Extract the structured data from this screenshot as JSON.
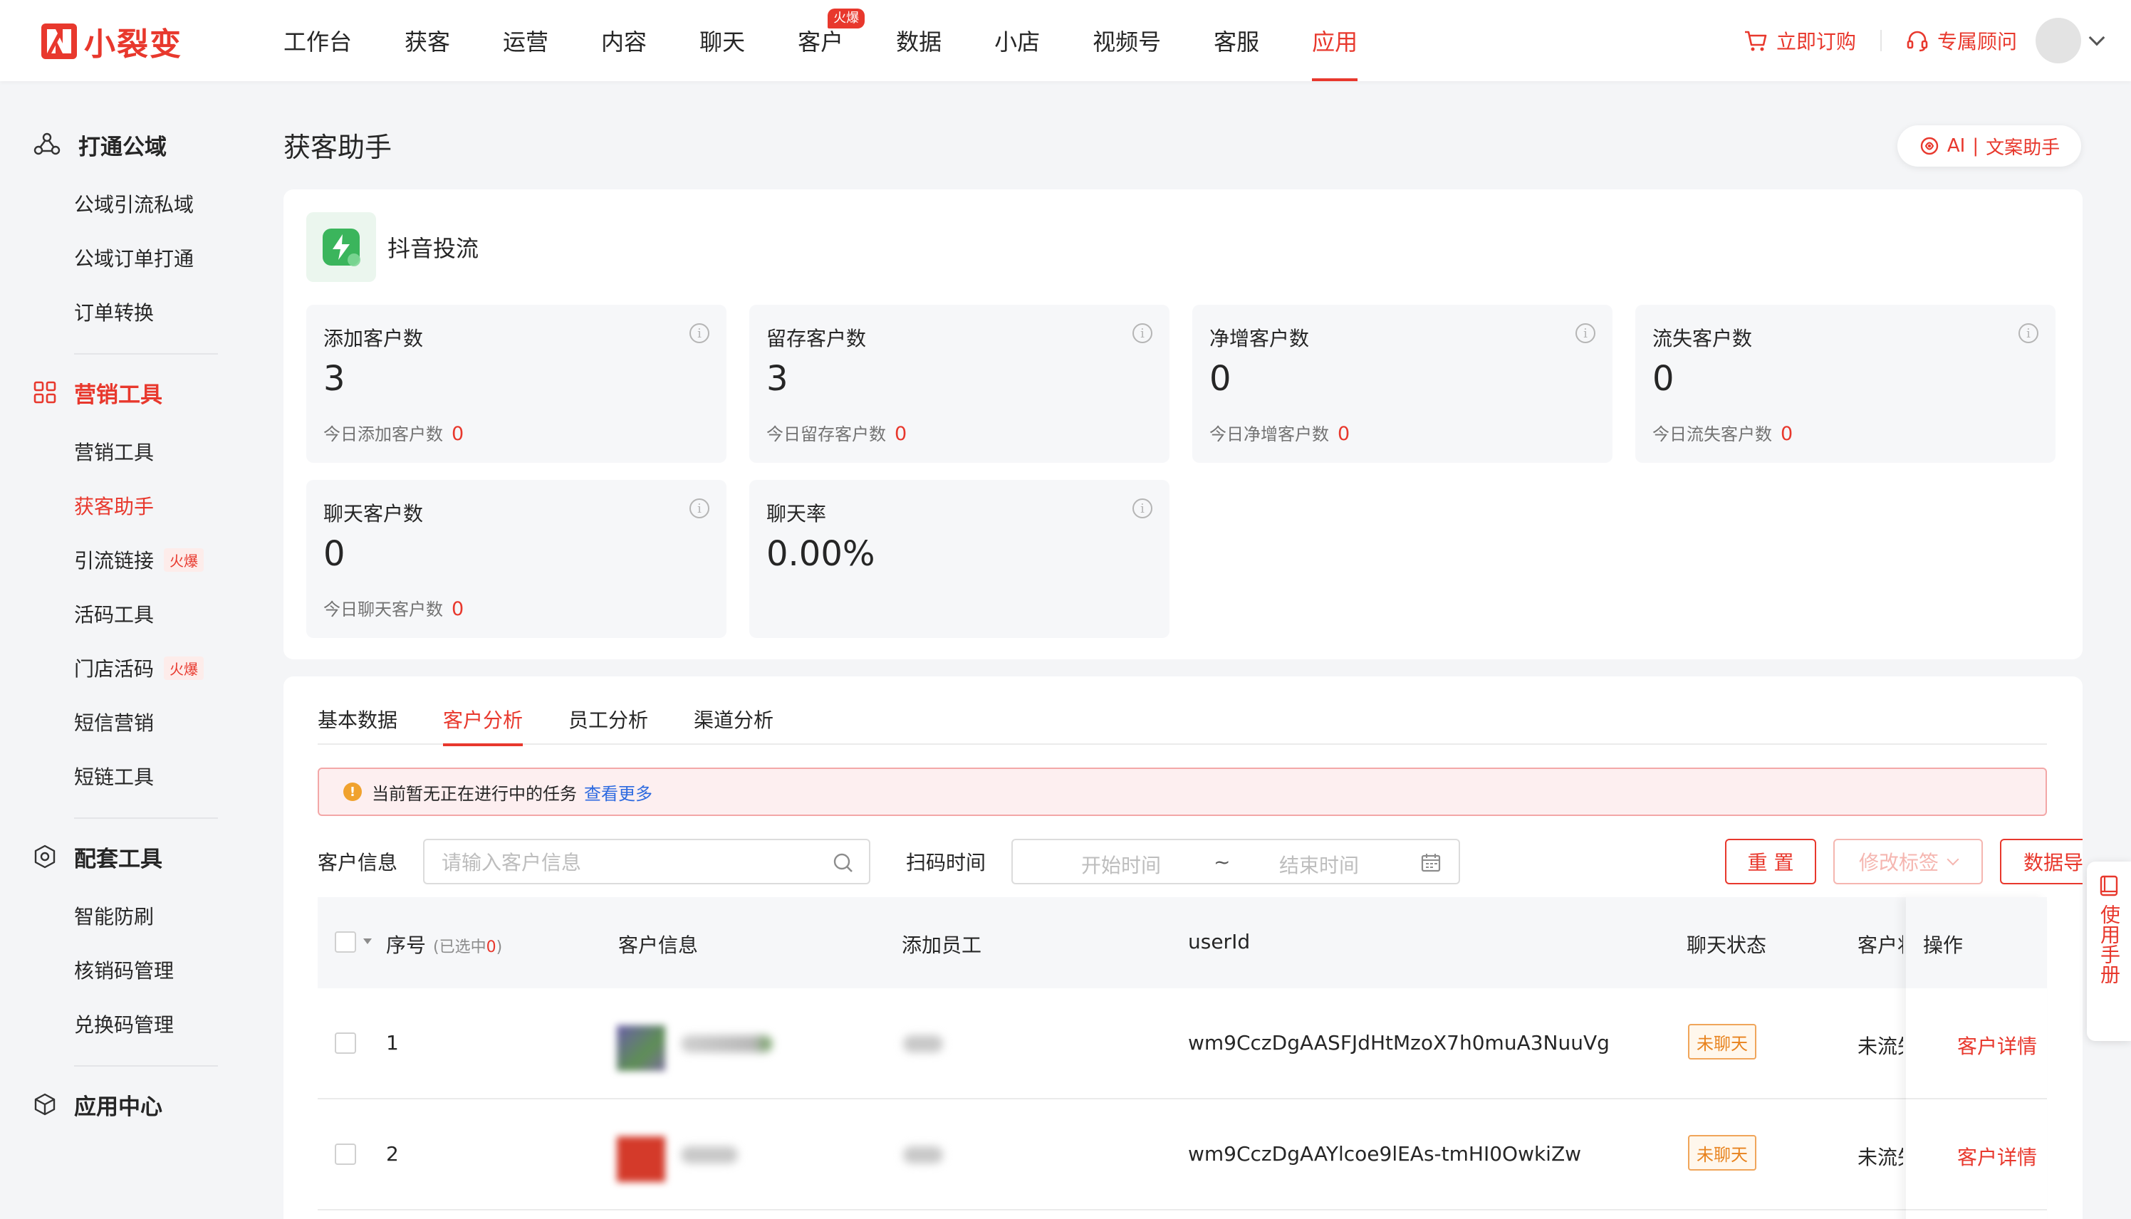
{
  "brand": {
    "name": "小裂变",
    "color": "#e8382d"
  },
  "nav": {
    "items": [
      {
        "label": "工作台"
      },
      {
        "label": "获客"
      },
      {
        "label": "运营"
      },
      {
        "label": "内容"
      },
      {
        "label": "聊天"
      },
      {
        "label": "客户",
        "badge": "火爆"
      },
      {
        "label": "数据"
      },
      {
        "label": "小店"
      },
      {
        "label": "视频号"
      },
      {
        "label": "客服"
      },
      {
        "label": "应用",
        "active": true
      }
    ],
    "buy_label": "立即订购",
    "advisor_label": "专属顾问"
  },
  "sidebar": {
    "groups": [
      {
        "title": "打通公域",
        "icon": "network-icon",
        "items": [
          {
            "label": "公域引流私域"
          },
          {
            "label": "公域订单打通"
          },
          {
            "label": "订单转换"
          }
        ]
      },
      {
        "title": "营销工具",
        "icon": "grid-icon",
        "active": true,
        "items": [
          {
            "label": "营销工具"
          },
          {
            "label": "获客助手",
            "active": true
          },
          {
            "label": "引流链接",
            "badge": "火爆"
          },
          {
            "label": "活码工具"
          },
          {
            "label": "门店活码",
            "badge": "火爆"
          },
          {
            "label": "短信营销"
          },
          {
            "label": "短链工具"
          }
        ]
      },
      {
        "title": "配套工具",
        "icon": "shield-icon",
        "items": [
          {
            "label": "智能防刷"
          },
          {
            "label": "核销码管理"
          },
          {
            "label": "兑换码管理"
          }
        ]
      },
      {
        "title": "应用中心",
        "icon": "cube-icon",
        "items": []
      }
    ]
  },
  "page": {
    "title": "获客助手",
    "ai_label": "AI",
    "ai_assistant": "文案助手"
  },
  "source": {
    "title": "抖音投流"
  },
  "stats": [
    {
      "label": "添加客户数",
      "value": "3",
      "sub_label": "今日添加客户数",
      "sub_value": "0"
    },
    {
      "label": "留存客户数",
      "value": "3",
      "sub_label": "今日留存客户数",
      "sub_value": "0"
    },
    {
      "label": "净增客户数",
      "value": "0",
      "sub_label": "今日净增客户数",
      "sub_value": "0"
    },
    {
      "label": "流失客户数",
      "value": "0",
      "sub_label": "今日流失客户数",
      "sub_value": "0"
    },
    {
      "label": "聊天客户数",
      "value": "0",
      "sub_label": "今日聊天客户数",
      "sub_value": "0"
    },
    {
      "label": "聊天率",
      "value": "0.00%",
      "sub_label": "",
      "sub_value": ""
    }
  ],
  "tabs": [
    {
      "label": "基本数据"
    },
    {
      "label": "客户分析",
      "active": true
    },
    {
      "label": "员工分析"
    },
    {
      "label": "渠道分析"
    }
  ],
  "alert": {
    "text": "当前暂无正在进行中的任务",
    "link": "查看更多"
  },
  "filters": {
    "customer_label": "客户信息",
    "customer_placeholder": "请输入客户信息",
    "time_label": "扫码时间",
    "start_placeholder": "开始时间",
    "range_sep": "~",
    "end_placeholder": "结束时间",
    "reset_label": "重 置",
    "tag_label": "修改标签",
    "export_label": "数据导出"
  },
  "table": {
    "columns": {
      "index": "序号",
      "selected_prefix": "(已选中",
      "selected_count": "0",
      "selected_suffix": ")",
      "customer": "客户信息",
      "staff": "添加员工",
      "userid": "userId",
      "chat_status": "聊天状态",
      "customer_status": "客户状",
      "action": "操作"
    },
    "rows": [
      {
        "index": "1",
        "userid": "wm9CczDgAASFJdHtMzoX7h0muA3NuuVg",
        "chat_status": "未聊天",
        "customer_status": "未流失",
        "action": "客户详情"
      },
      {
        "index": "2",
        "userid": "wm9CczDgAAYlcoe9lEAs-tmHI0OwkiZw",
        "chat_status": "未聊天",
        "customer_status": "未流失",
        "action": "客户详情"
      }
    ]
  },
  "manual": {
    "label": "使用手册"
  }
}
